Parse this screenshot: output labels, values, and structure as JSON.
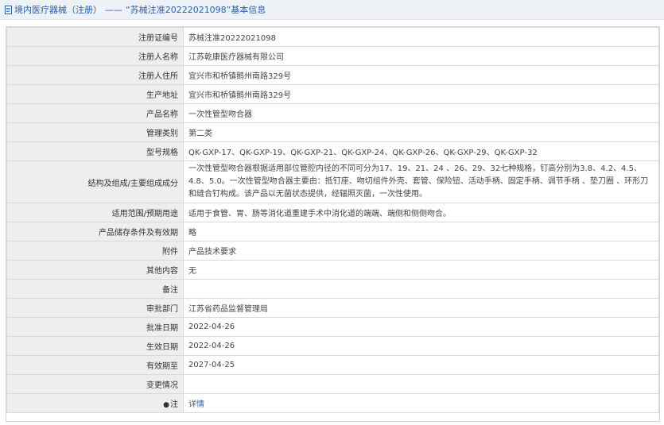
{
  "header": {
    "section": "境内医疗器械（注册）",
    "dash": "——",
    "title": "“苏械注准20222021098”基本信息"
  },
  "rows": [
    {
      "label": "注册证编号",
      "value": "苏械注准20222021098"
    },
    {
      "label": "注册人名称",
      "value": "江苏乾康医疗器械有限公司"
    },
    {
      "label": "注册人住所",
      "value": "宜兴市和桥镇鹅州南路329号"
    },
    {
      "label": "生产地址",
      "value": "宜兴市和桥镇鹅州南路329号"
    },
    {
      "label": "产品名称",
      "value": "一次性管型吻合器"
    },
    {
      "label": "管理类别",
      "value": "第二类"
    },
    {
      "label": "型号规格",
      "value": "QK-GXP-17、QK-GXP-19、QK-GXP-21、QK-GXP-24、QK-GXP-26、QK-GXP-29、QK-GXP-32"
    },
    {
      "label": "结构及组成/主要组成成分",
      "value": "一次性管型吻合器根据适用部位管腔内径的不同可分为17、19、21、24 、26、29、32七种规格，钉高分别为3.8、4.2、4.5、4.8、5.0。一次性管型吻合器主要由：抵钉座、吻切组件外壳、套管、保险钮、活动手柄、固定手柄、调节手柄 、垫刀圈 、环形刀和缝合钉构成。该产品以无菌状态提供，经辐照灭菌，一次性使用。"
    },
    {
      "label": "适用范围/预期用途",
      "value": "适用于食管、胃、肠等消化道重建手术中消化道的端端、端侧和侧侧吻合。"
    },
    {
      "label": "产品储存条件及有效期",
      "value": "略"
    },
    {
      "label": "附件",
      "value": "产品技术要求"
    },
    {
      "label": "其他内容",
      "value": "无"
    },
    {
      "label": "备注",
      "value": ""
    },
    {
      "label": "审批部门",
      "value": "江苏省药品监督管理局"
    },
    {
      "label": "批准日期",
      "value": "2022-04-26"
    },
    {
      "label": "生效日期",
      "value": "2022-04-26"
    },
    {
      "label": "有效期至",
      "value": "2027-04-25"
    },
    {
      "label": "变更情况",
      "value": ""
    }
  ],
  "note": {
    "icon": "●",
    "label": "注",
    "link": "详情"
  }
}
